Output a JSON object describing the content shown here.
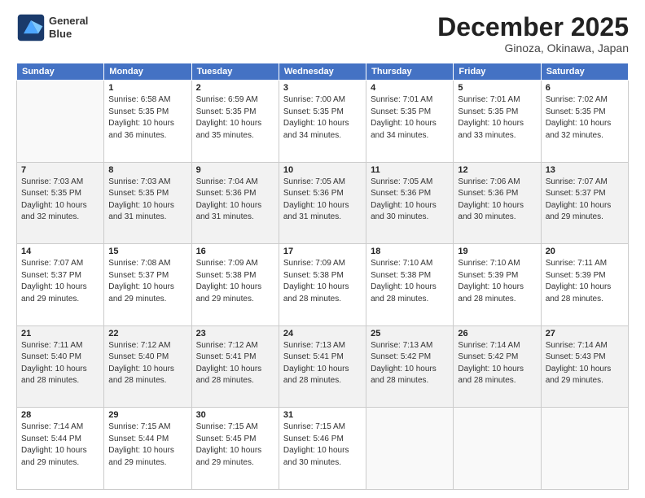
{
  "header": {
    "logo_line1": "General",
    "logo_line2": "Blue",
    "title": "December 2025",
    "subtitle": "Ginoza, Okinawa, Japan"
  },
  "days_of_week": [
    "Sunday",
    "Monday",
    "Tuesday",
    "Wednesday",
    "Thursday",
    "Friday",
    "Saturday"
  ],
  "weeks": [
    [
      {
        "day": "",
        "info": ""
      },
      {
        "day": "1",
        "info": "Sunrise: 6:58 AM\nSunset: 5:35 PM\nDaylight: 10 hours\nand 36 minutes."
      },
      {
        "day": "2",
        "info": "Sunrise: 6:59 AM\nSunset: 5:35 PM\nDaylight: 10 hours\nand 35 minutes."
      },
      {
        "day": "3",
        "info": "Sunrise: 7:00 AM\nSunset: 5:35 PM\nDaylight: 10 hours\nand 34 minutes."
      },
      {
        "day": "4",
        "info": "Sunrise: 7:01 AM\nSunset: 5:35 PM\nDaylight: 10 hours\nand 34 minutes."
      },
      {
        "day": "5",
        "info": "Sunrise: 7:01 AM\nSunset: 5:35 PM\nDaylight: 10 hours\nand 33 minutes."
      },
      {
        "day": "6",
        "info": "Sunrise: 7:02 AM\nSunset: 5:35 PM\nDaylight: 10 hours\nand 32 minutes."
      }
    ],
    [
      {
        "day": "7",
        "info": "Sunrise: 7:03 AM\nSunset: 5:35 PM\nDaylight: 10 hours\nand 32 minutes."
      },
      {
        "day": "8",
        "info": "Sunrise: 7:03 AM\nSunset: 5:35 PM\nDaylight: 10 hours\nand 31 minutes."
      },
      {
        "day": "9",
        "info": "Sunrise: 7:04 AM\nSunset: 5:36 PM\nDaylight: 10 hours\nand 31 minutes."
      },
      {
        "day": "10",
        "info": "Sunrise: 7:05 AM\nSunset: 5:36 PM\nDaylight: 10 hours\nand 31 minutes."
      },
      {
        "day": "11",
        "info": "Sunrise: 7:05 AM\nSunset: 5:36 PM\nDaylight: 10 hours\nand 30 minutes."
      },
      {
        "day": "12",
        "info": "Sunrise: 7:06 AM\nSunset: 5:36 PM\nDaylight: 10 hours\nand 30 minutes."
      },
      {
        "day": "13",
        "info": "Sunrise: 7:07 AM\nSunset: 5:37 PM\nDaylight: 10 hours\nand 29 minutes."
      }
    ],
    [
      {
        "day": "14",
        "info": "Sunrise: 7:07 AM\nSunset: 5:37 PM\nDaylight: 10 hours\nand 29 minutes."
      },
      {
        "day": "15",
        "info": "Sunrise: 7:08 AM\nSunset: 5:37 PM\nDaylight: 10 hours\nand 29 minutes."
      },
      {
        "day": "16",
        "info": "Sunrise: 7:09 AM\nSunset: 5:38 PM\nDaylight: 10 hours\nand 29 minutes."
      },
      {
        "day": "17",
        "info": "Sunrise: 7:09 AM\nSunset: 5:38 PM\nDaylight: 10 hours\nand 28 minutes."
      },
      {
        "day": "18",
        "info": "Sunrise: 7:10 AM\nSunset: 5:38 PM\nDaylight: 10 hours\nand 28 minutes."
      },
      {
        "day": "19",
        "info": "Sunrise: 7:10 AM\nSunset: 5:39 PM\nDaylight: 10 hours\nand 28 minutes."
      },
      {
        "day": "20",
        "info": "Sunrise: 7:11 AM\nSunset: 5:39 PM\nDaylight: 10 hours\nand 28 minutes."
      }
    ],
    [
      {
        "day": "21",
        "info": "Sunrise: 7:11 AM\nSunset: 5:40 PM\nDaylight: 10 hours\nand 28 minutes."
      },
      {
        "day": "22",
        "info": "Sunrise: 7:12 AM\nSunset: 5:40 PM\nDaylight: 10 hours\nand 28 minutes."
      },
      {
        "day": "23",
        "info": "Sunrise: 7:12 AM\nSunset: 5:41 PM\nDaylight: 10 hours\nand 28 minutes."
      },
      {
        "day": "24",
        "info": "Sunrise: 7:13 AM\nSunset: 5:41 PM\nDaylight: 10 hours\nand 28 minutes."
      },
      {
        "day": "25",
        "info": "Sunrise: 7:13 AM\nSunset: 5:42 PM\nDaylight: 10 hours\nand 28 minutes."
      },
      {
        "day": "26",
        "info": "Sunrise: 7:14 AM\nSunset: 5:42 PM\nDaylight: 10 hours\nand 28 minutes."
      },
      {
        "day": "27",
        "info": "Sunrise: 7:14 AM\nSunset: 5:43 PM\nDaylight: 10 hours\nand 29 minutes."
      }
    ],
    [
      {
        "day": "28",
        "info": "Sunrise: 7:14 AM\nSunset: 5:44 PM\nDaylight: 10 hours\nand 29 minutes."
      },
      {
        "day": "29",
        "info": "Sunrise: 7:15 AM\nSunset: 5:44 PM\nDaylight: 10 hours\nand 29 minutes."
      },
      {
        "day": "30",
        "info": "Sunrise: 7:15 AM\nSunset: 5:45 PM\nDaylight: 10 hours\nand 29 minutes."
      },
      {
        "day": "31",
        "info": "Sunrise: 7:15 AM\nSunset: 5:46 PM\nDaylight: 10 hours\nand 30 minutes."
      },
      {
        "day": "",
        "info": ""
      },
      {
        "day": "",
        "info": ""
      },
      {
        "day": "",
        "info": ""
      }
    ]
  ]
}
